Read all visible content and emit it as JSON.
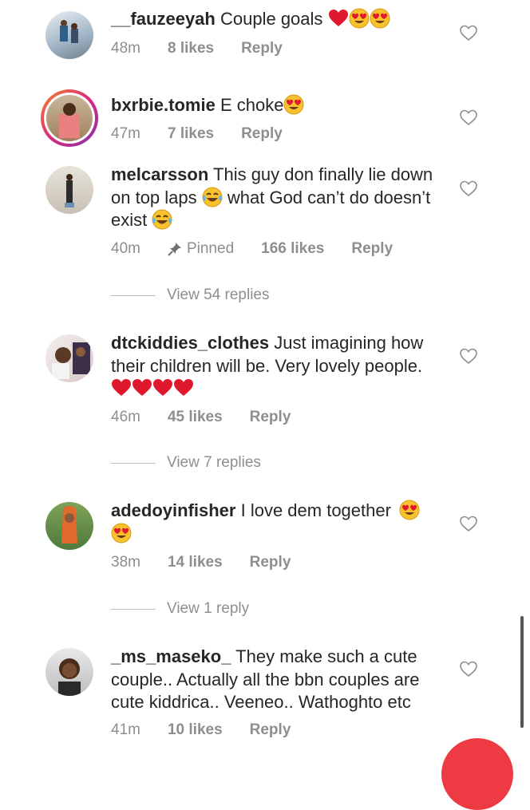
{
  "comments": [
    {
      "user": "__fauzeeyah",
      "text": "Couple goals",
      "time": "48m",
      "likes": "8 likes",
      "reply": "Reply"
    },
    {
      "user": "bxrbie.tomie",
      "text": "E choke",
      "time": "47m",
      "likes": "7 likes",
      "reply": "Reply"
    },
    {
      "user": "melcarsson",
      "text_parts": [
        "This guy don finally lie down on top laps ",
        "what God can’t do doesn’t exist "
      ],
      "time": "40m",
      "pinned": "Pinned",
      "likes": "166 likes",
      "reply": "Reply",
      "view_replies": "View 54 replies"
    },
    {
      "user": "dtckiddies_clothes",
      "text": "Just imagining how their children will be. Very lovely people.",
      "time": "46m",
      "likes": "45 likes",
      "reply": "Reply",
      "view_replies": "View 7 replies"
    },
    {
      "user": "adedoyinfisher",
      "text": "I love dem together",
      "time": "38m",
      "likes": "14 likes",
      "reply": "Reply",
      "view_replies": "View 1 reply"
    },
    {
      "user": "_ms_maseko_",
      "text": "They make such a cute couple.. Actually all the bbn couples are cute kiddrica.. Veeneo.. Wathoghto etc",
      "time": "41m",
      "likes": "10 likes",
      "reply": "Reply"
    }
  ],
  "colors": {
    "text": "#262626",
    "meta": "#8e8e8e",
    "heart_emoji": "#e0182d",
    "accent_fab": "#ee3b43"
  },
  "icons": [
    "heart-outline-icon",
    "heart-eyes-emoji",
    "red-heart-emoji",
    "tears-of-joy-emoji",
    "pin-icon"
  ]
}
